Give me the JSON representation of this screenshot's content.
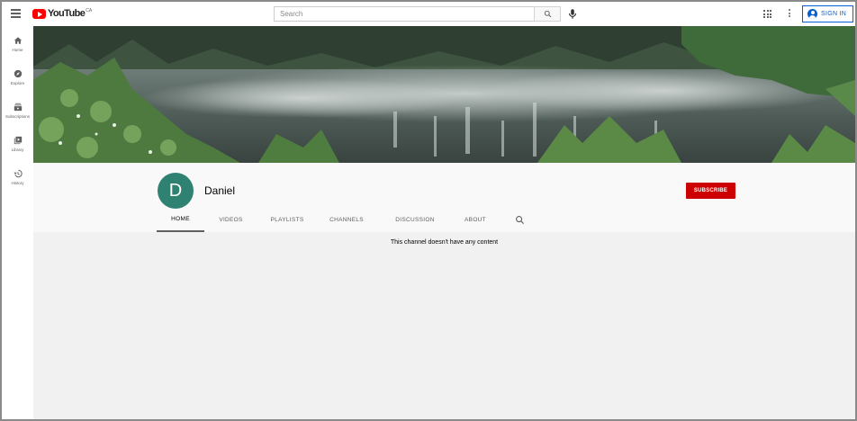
{
  "header": {
    "logo_text": "YouTube",
    "region": "CA",
    "search_placeholder": "Search",
    "signin_label": "SIGN IN"
  },
  "sidebar": {
    "items": [
      {
        "label": "Home",
        "icon": "home-icon"
      },
      {
        "label": "Explore",
        "icon": "compass-icon"
      },
      {
        "label": "Subscriptions",
        "icon": "subscriptions-icon"
      },
      {
        "label": "Library",
        "icon": "library-icon"
      },
      {
        "label": "History",
        "icon": "history-icon"
      }
    ]
  },
  "channel": {
    "avatar_letter": "D",
    "name": "Daniel",
    "subscribe_label": "SUBSCRIBE",
    "tabs": [
      "HOME",
      "VIDEOS",
      "PLAYLISTS",
      "CHANNELS",
      "DISCUSSION",
      "ABOUT"
    ],
    "active_tab": "HOME",
    "empty_message": "This channel doesn't have any content"
  },
  "colors": {
    "brand_red": "#ff0000",
    "subscribe_red": "#cc0000",
    "avatar_teal": "#2f8172",
    "link_blue": "#065fd4"
  }
}
